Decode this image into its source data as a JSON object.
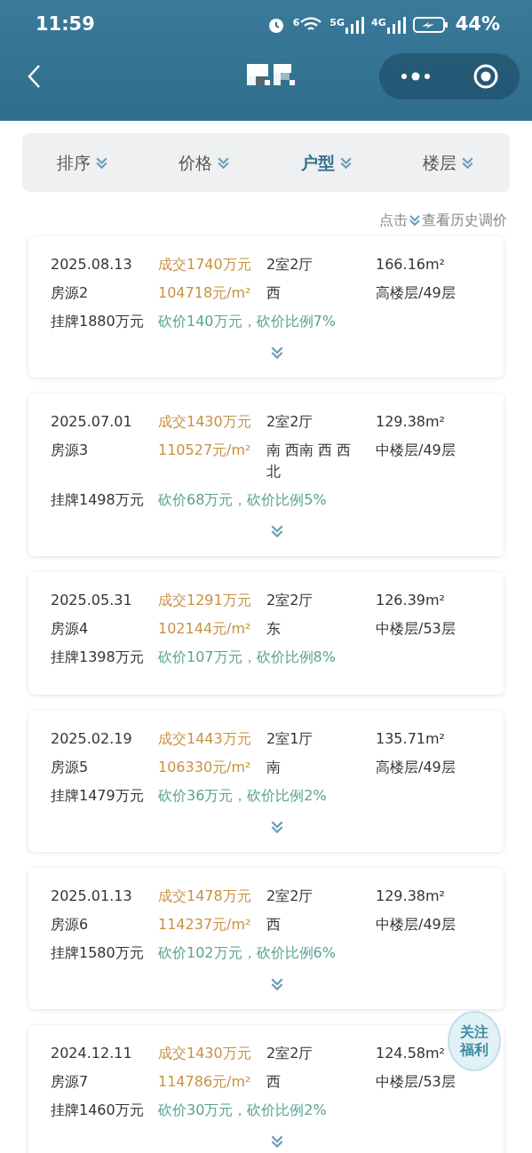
{
  "status_bar": {
    "time": "11:59",
    "battery": "44%",
    "network_labels": [
      "6",
      "5G",
      "4G"
    ]
  },
  "nav": {
    "title_pixelated": true
  },
  "filters": [
    {
      "label": "排序",
      "selected": false
    },
    {
      "label": "价格",
      "selected": false
    },
    {
      "label": "户型",
      "selected": true
    },
    {
      "label": "楼层",
      "selected": false
    }
  ],
  "history_hint": {
    "before": "点击",
    "after": "查看历史调价"
  },
  "records": [
    {
      "date": "2025.08.13",
      "deal": "成交1740万元",
      "layout": "2室2厅",
      "area": "166.16m²",
      "source": "房源2",
      "unit_price": "104718元/m²",
      "orientation": "西",
      "floor": "高楼层/49层",
      "listing": "挂牌1880万元",
      "discount": "砍价140万元，砍价比例7%",
      "expandable": true
    },
    {
      "date": "2025.07.01",
      "deal": "成交1430万元",
      "layout": "2室2厅",
      "area": "129.38m²",
      "source": "房源3",
      "unit_price": "110527元/m²",
      "orientation": "南 西南 西 西北",
      "floor": "中楼层/49层",
      "listing": "挂牌1498万元",
      "discount": "砍价68万元，砍价比例5%",
      "expandable": true
    },
    {
      "date": "2025.05.31",
      "deal": "成交1291万元",
      "layout": "2室2厅",
      "area": "126.39m²",
      "source": "房源4",
      "unit_price": "102144元/m²",
      "orientation": "东",
      "floor": "中楼层/53层",
      "listing": "挂牌1398万元",
      "discount": "砍价107万元，砍价比例8%",
      "expandable": false
    },
    {
      "date": "2025.02.19",
      "deal": "成交1443万元",
      "layout": "2室1厅",
      "area": "135.71m²",
      "source": "房源5",
      "unit_price": "106330元/m²",
      "orientation": "南",
      "floor": "高楼层/49层",
      "listing": "挂牌1479万元",
      "discount": "砍价36万元，砍价比例2%",
      "expandable": true
    },
    {
      "date": "2025.01.13",
      "deal": "成交1478万元",
      "layout": "2室2厅",
      "area": "129.38m²",
      "source": "房源6",
      "unit_price": "114237元/m²",
      "orientation": "西",
      "floor": "中楼层/49层",
      "listing": "挂牌1580万元",
      "discount": "砍价102万元，砍价比例6%",
      "expandable": true
    },
    {
      "date": "2024.12.11",
      "deal": "成交1430万元",
      "layout": "2室2厅",
      "area": "124.58m²",
      "source": "房源7",
      "unit_price": "114786元/m²",
      "orientation": "西",
      "floor": "中楼层/53层",
      "listing": "挂牌1460万元",
      "discount": "砍价30万元，砍价比例2%",
      "expandable": true
    }
  ],
  "float_button": {
    "line1": "关注",
    "line2": "福利"
  }
}
